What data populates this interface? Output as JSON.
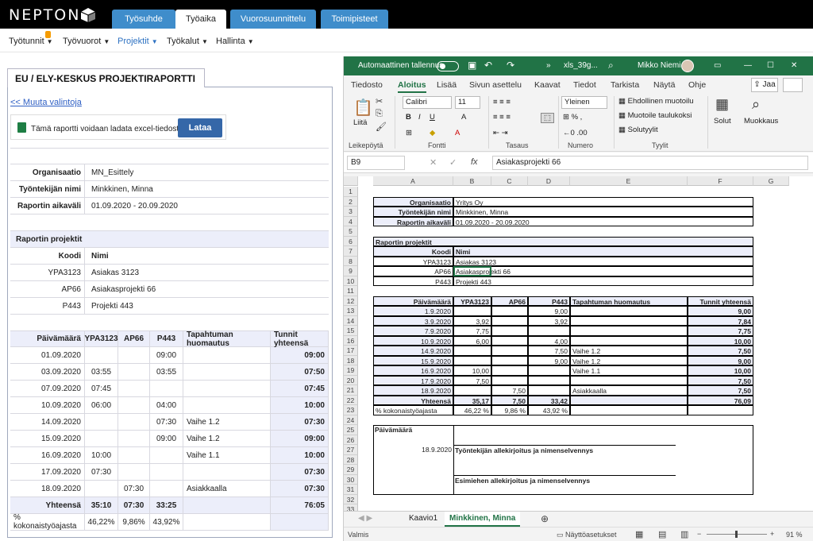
{
  "app": {
    "logo": "NEPTON",
    "tabs": [
      "Työsuhde",
      "Työaika",
      "Vuorosuunnittelu",
      "Toimipisteet"
    ],
    "active_tab": "Työaika",
    "badge": "1"
  },
  "nav": [
    "Työtunnit",
    "Työvuorot",
    "Projektit",
    "Työkalut",
    "Hallinta"
  ],
  "report": {
    "title": "EU / ELY-KESKUS PROJEKTIRAPORTTI",
    "change_link": "<< Muuta valintoja",
    "download_text": "Tämä raportti voidaan ladata excel-tiedostona",
    "download_button": "Lataa",
    "info": [
      {
        "label": "Organisaatio",
        "value": "MN_Esittely"
      },
      {
        "label": "Työntekijän nimi",
        "value": "Minkkinen, Minna"
      },
      {
        "label": "Raportin aikaväli",
        "value": "01.09.2020 - 20.09.2020"
      }
    ],
    "projects_title": "Raportin projektit",
    "projects_header": [
      "Koodi",
      "Nimi"
    ],
    "projects": [
      [
        "YPA3123",
        "Asiakas 3123"
      ],
      [
        "AP66",
        "Asiakasprojekti 66"
      ],
      [
        "P443",
        "Projekti 443"
      ]
    ],
    "table_header": [
      "Päivämäärä",
      "YPA3123",
      "AP66",
      "P443",
      "Tapahtuman huomautus",
      "Tunnit yhteensä"
    ],
    "rows": [
      [
        "01.09.2020",
        "",
        "",
        "09:00",
        "",
        "09:00"
      ],
      [
        "03.09.2020",
        "03:55",
        "",
        "03:55",
        "",
        "07:50"
      ],
      [
        "07.09.2020",
        "07:45",
        "",
        "",
        "",
        "07:45"
      ],
      [
        "10.09.2020",
        "06:00",
        "",
        "04:00",
        "",
        "10:00"
      ],
      [
        "14.09.2020",
        "",
        "",
        "07:30",
        "Vaihe 1.2",
        "07:30"
      ],
      [
        "15.09.2020",
        "",
        "",
        "09:00",
        "Vaihe 1.2",
        "09:00"
      ],
      [
        "16.09.2020",
        "10:00",
        "",
        "",
        "Vaihe 1.1",
        "10:00"
      ],
      [
        "17.09.2020",
        "07:30",
        "",
        "",
        "",
        "07:30"
      ],
      [
        "18.09.2020",
        "",
        "07:30",
        "",
        "Asiakkaalla",
        "07:30"
      ]
    ],
    "total": [
      "Yhteensä",
      "35:10",
      "07:30",
      "33:25",
      "",
      "76:05"
    ],
    "percent": [
      "% kokonaistyöajasta",
      "46,22%",
      "9,86%",
      "43,92%",
      "",
      ""
    ]
  },
  "excel": {
    "autosave": "Automaattinen tallennus",
    "filename": "xls_39g...",
    "user": "Mikko Niemi",
    "menu": [
      "Tiedosto",
      "Aloitus",
      "Lisää",
      "Sivun asettelu",
      "Kaavat",
      "Tiedot",
      "Tarkista",
      "Näytä",
      "Ohje"
    ],
    "active_menu": "Aloitus",
    "share": "Jaa",
    "ribbon": {
      "paste": "Liitä",
      "font": "Calibri",
      "size": "11",
      "numfmt": "Yleinen",
      "cond": "Ehdollinen muotoilu",
      "table": "Muotoile taulukoksi",
      "styles": "Solutyylit",
      "cells": "Solut",
      "edit": "Muokkaus",
      "groups": [
        "Leikepöytä",
        "Fontti",
        "Tasaus",
        "Numero",
        "Tyylit"
      ]
    },
    "namebox": "B9",
    "fx": "fx",
    "formula": "Asiakasprojekti 66",
    "columns": [
      "A",
      "B",
      "C",
      "D",
      "E",
      "F",
      "G"
    ],
    "sheet": {
      "info": [
        [
          "Organisaatio",
          "Yritys Oy"
        ],
        [
          "Työntekijän nimi",
          "Minkkinen, Minna"
        ],
        [
          "Raportin aikaväli",
          "01.09.2020 - 20.09.2020"
        ]
      ],
      "projects_title": "Raportin projektit",
      "projects_header": [
        "Koodi",
        "Nimi"
      ],
      "projects": [
        [
          "YPA3123",
          "Asiakas 3123"
        ],
        [
          "AP66",
          "Asiakasprojekti 66"
        ],
        [
          "P443",
          "Projekti 443"
        ]
      ],
      "header": [
        "Päivämäärä",
        "YPA3123",
        "AP66",
        "P443",
        "Tapahtuman huomautus",
        "Tunnit yhteensä"
      ],
      "rows": [
        [
          "1.9.2020",
          "",
          "",
          "9,00",
          "",
          "9,00"
        ],
        [
          "3.9.2020",
          "3,92",
          "",
          "3,92",
          "",
          "7,84"
        ],
        [
          "7.9.2020",
          "7,75",
          "",
          "",
          "",
          "7,75"
        ],
        [
          "10.9.2020",
          "6,00",
          "",
          "4,00",
          "",
          "10,00"
        ],
        [
          "14.9.2020",
          "",
          "",
          "7,50",
          "Vaihe 1.2",
          "7,50"
        ],
        [
          "15.9.2020",
          "",
          "",
          "9,00",
          "Vaihe 1.2",
          "9,00"
        ],
        [
          "16.9.2020",
          "10,00",
          "",
          "",
          "Vaihe 1.1",
          "10,00"
        ],
        [
          "17.9.2020",
          "7,50",
          "",
          "",
          "",
          "7,50"
        ],
        [
          "18.9.2020",
          "",
          "7,50",
          "",
          "Asiakkaalla",
          "7,50"
        ]
      ],
      "total": [
        "Yhteensä",
        "35,17",
        "7,50",
        "33,42",
        "",
        "76,09"
      ],
      "percent": [
        "% kokonaistyöajasta",
        "46,22 %",
        "9,86 %",
        "43,92 %",
        "",
        ""
      ],
      "sig_label": "Päivämäärä",
      "sig_date": "18.9.2020",
      "sig1": "Työntekijän allekirjoitus ja nimenselvennys",
      "sig2": "Esimiehen allekirjoitus ja nimenselvennys"
    },
    "sheet_tabs": [
      "Kaavio1",
      "Minkkinen, Minna"
    ],
    "active_sheet": "Minkkinen, Minna",
    "status": {
      "ready": "Valmis",
      "display": "Näyttöasetukset",
      "zoom": "91 %"
    }
  }
}
